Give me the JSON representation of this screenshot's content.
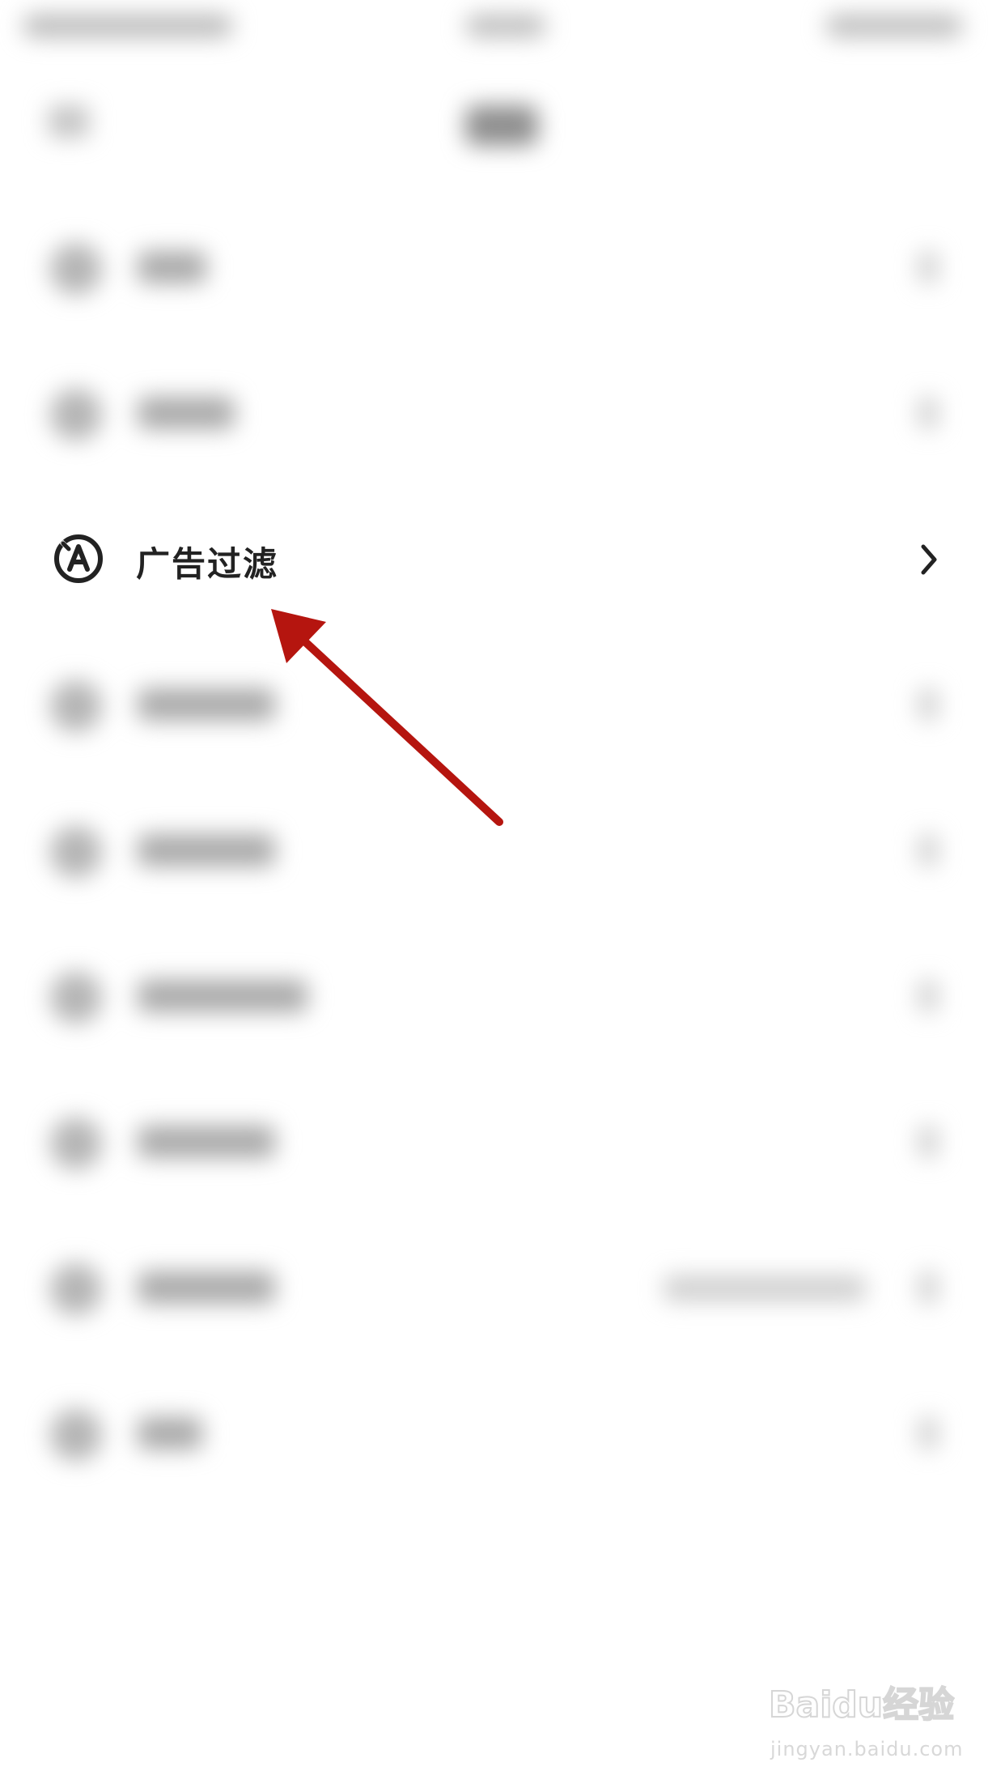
{
  "ad_filter_row": {
    "label": "广告过滤",
    "icon": "ad-block-icon",
    "chevron": "chevron-right-icon"
  },
  "annotation": {
    "icon": "red-arrow-pointer",
    "color": "#b5150f"
  },
  "watermark": {
    "brand_text": "Baidu经验",
    "url": "jingyan.baidu.com"
  },
  "colors": {
    "background": "#ffffff",
    "text_primary": "#222222",
    "arrow": "#b5150f"
  }
}
